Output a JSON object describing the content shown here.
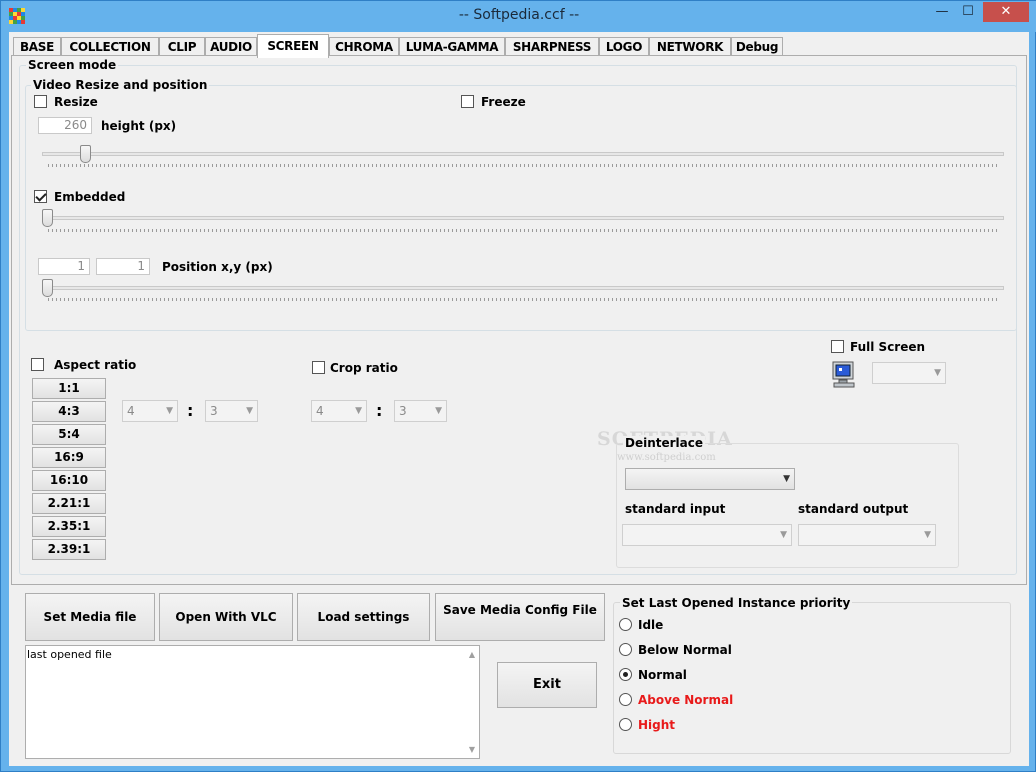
{
  "window": {
    "title": "-- Softpedia.ccf --",
    "minimize_glyph": "—",
    "maximize_glyph": "☐",
    "close_glyph": "✕"
  },
  "tabs": [
    {
      "label": "BASE"
    },
    {
      "label": "COLLECTION"
    },
    {
      "label": "CLIP"
    },
    {
      "label": "AUDIO"
    },
    {
      "label": "SCREEN",
      "active": true
    },
    {
      "label": "CHROMA"
    },
    {
      "label": "LUMA-GAMMA"
    },
    {
      "label": "SHARPNESS"
    },
    {
      "label": "LOGO"
    },
    {
      "label": "NETWORK"
    },
    {
      "label": "Debug"
    }
  ],
  "screen": {
    "screen_mode_label": "Screen mode",
    "video_resize_label": "Video Resize and position",
    "resize_label": "Resize",
    "resize_checked": false,
    "freeze_label": "Freeze",
    "freeze_checked": false,
    "height_value": "260",
    "height_label": "height (px)",
    "height_slider_level": 0.04,
    "embedded_label": "Embedded",
    "embedded_checked": true,
    "embedded_slider_level": 0.0,
    "position_x": "1",
    "position_y": "1",
    "position_label": "Position x,y (px)",
    "position_slider_level": 0.0
  },
  "aspect": {
    "label": "Aspect ratio",
    "checked": false,
    "buttons": [
      "1:1",
      "4:3",
      "5:4",
      "16:9",
      "16:10",
      "2.21:1",
      "2.35:1",
      "2.39:1"
    ],
    "num": "4",
    "den": "3",
    "separator": ":"
  },
  "crop": {
    "label": "Crop ratio",
    "checked": false,
    "num": "4",
    "den": "3",
    "separator": ":"
  },
  "fullscreen": {
    "label": "Full Screen",
    "checked": false,
    "icon": "monitor-icon"
  },
  "deinterlace": {
    "label": "Deinterlace",
    "standard_input_label": "standard input",
    "standard_output_label": "standard output"
  },
  "watermark": {
    "text": "SOFTPEDIA",
    "url": "www.softpedia.com"
  },
  "actions": {
    "set_media_file": "Set Media file",
    "open_with_vlc": "Open With VLC",
    "load_settings": "Load settings",
    "save_media_config": "Save Media Config File",
    "exit": "Exit",
    "log_text": "last opened file"
  },
  "priority": {
    "label": "Set Last Opened Instance priority",
    "options": [
      {
        "label": "Idle",
        "selected": false,
        "color": "#000000"
      },
      {
        "label": "Below Normal",
        "selected": false,
        "color": "#000000"
      },
      {
        "label": "Normal",
        "selected": true,
        "color": "#000000"
      },
      {
        "label": "Above Normal",
        "selected": false,
        "color": "#e81a1a"
      },
      {
        "label": "Hight",
        "selected": false,
        "color": "#e81a1a"
      }
    ]
  }
}
